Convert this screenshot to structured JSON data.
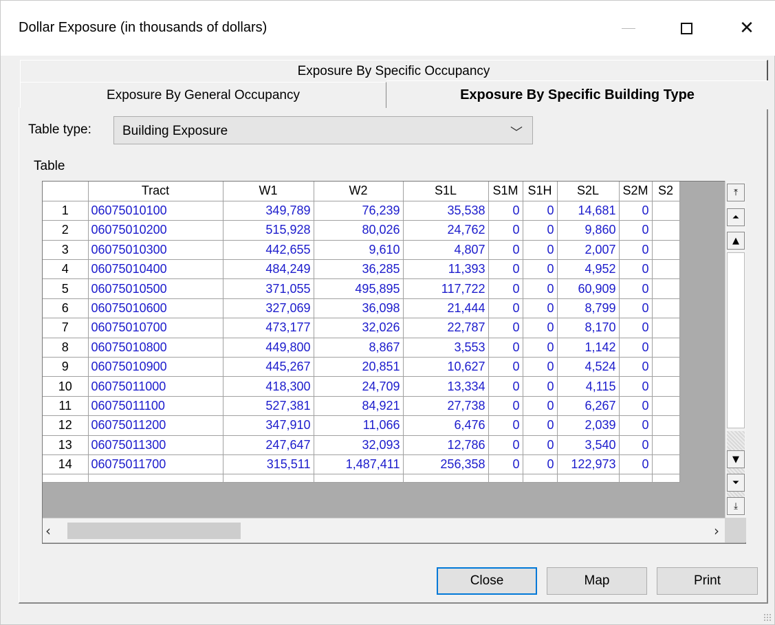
{
  "window": {
    "title": "Dollar Exposure (in thousands of dollars)",
    "controls": {
      "minimize": "—",
      "maximize": "☐",
      "close": "✕"
    }
  },
  "tabs": {
    "specific_occupancy": "Exposure By Specific Occupancy",
    "general_occupancy": "Exposure By General Occupancy",
    "specific_building_type": "Exposure By Specific Building Type",
    "active": "specific_building_type"
  },
  "table_type": {
    "label": "Table type:",
    "selected": "Building Exposure"
  },
  "table_label": "Table",
  "grid": {
    "columns": [
      "",
      "Tract",
      "W1",
      "W2",
      "S1L",
      "S1M",
      "S1H",
      "S2L",
      "S2M",
      "S2"
    ],
    "rows": [
      [
        "1",
        "06075010100",
        "349,789",
        "76,239",
        "35,538",
        "0",
        "0",
        "14,681",
        "0",
        ""
      ],
      [
        "2",
        "06075010200",
        "515,928",
        "80,026",
        "24,762",
        "0",
        "0",
        "9,860",
        "0",
        ""
      ],
      [
        "3",
        "06075010300",
        "442,655",
        "9,610",
        "4,807",
        "0",
        "0",
        "2,007",
        "0",
        ""
      ],
      [
        "4",
        "06075010400",
        "484,249",
        "36,285",
        "11,393",
        "0",
        "0",
        "4,952",
        "0",
        ""
      ],
      [
        "5",
        "06075010500",
        "371,055",
        "495,895",
        "117,722",
        "0",
        "0",
        "60,909",
        "0",
        ""
      ],
      [
        "6",
        "06075010600",
        "327,069",
        "36,098",
        "21,444",
        "0",
        "0",
        "8,799",
        "0",
        ""
      ],
      [
        "7",
        "06075010700",
        "473,177",
        "32,026",
        "22,787",
        "0",
        "0",
        "8,170",
        "0",
        ""
      ],
      [
        "8",
        "06075010800",
        "449,800",
        "8,867",
        "3,553",
        "0",
        "0",
        "1,142",
        "0",
        ""
      ],
      [
        "9",
        "06075010900",
        "445,267",
        "20,851",
        "10,627",
        "0",
        "0",
        "4,524",
        "0",
        ""
      ],
      [
        "10",
        "06075011000",
        "418,300",
        "24,709",
        "13,334",
        "0",
        "0",
        "4,115",
        "0",
        ""
      ],
      [
        "11",
        "06075011100",
        "527,381",
        "84,921",
        "27,738",
        "0",
        "0",
        "6,267",
        "0",
        ""
      ],
      [
        "12",
        "06075011200",
        "347,910",
        "11,066",
        "6,476",
        "0",
        "0",
        "2,039",
        "0",
        ""
      ],
      [
        "13",
        "06075011300",
        "247,647",
        "32,093",
        "12,786",
        "0",
        "0",
        "3,540",
        "0",
        ""
      ],
      [
        "14",
        "06075011700",
        "315,511",
        "1,487,411",
        "256,358",
        "0",
        "0",
        "122,973",
        "0",
        ""
      ]
    ],
    "colors": {
      "value_text": "#1c1ccc",
      "selected_button_border": "#0078d7"
    }
  },
  "scrollbar_icons": {
    "top": "⤒",
    "page_up": "⏶",
    "up": "▲",
    "down": "▼",
    "page_down": "⏷",
    "bottom": "⤓",
    "left": "‹",
    "right": "›"
  },
  "buttons": {
    "close": "Close",
    "map": "Map",
    "print": "Print"
  }
}
